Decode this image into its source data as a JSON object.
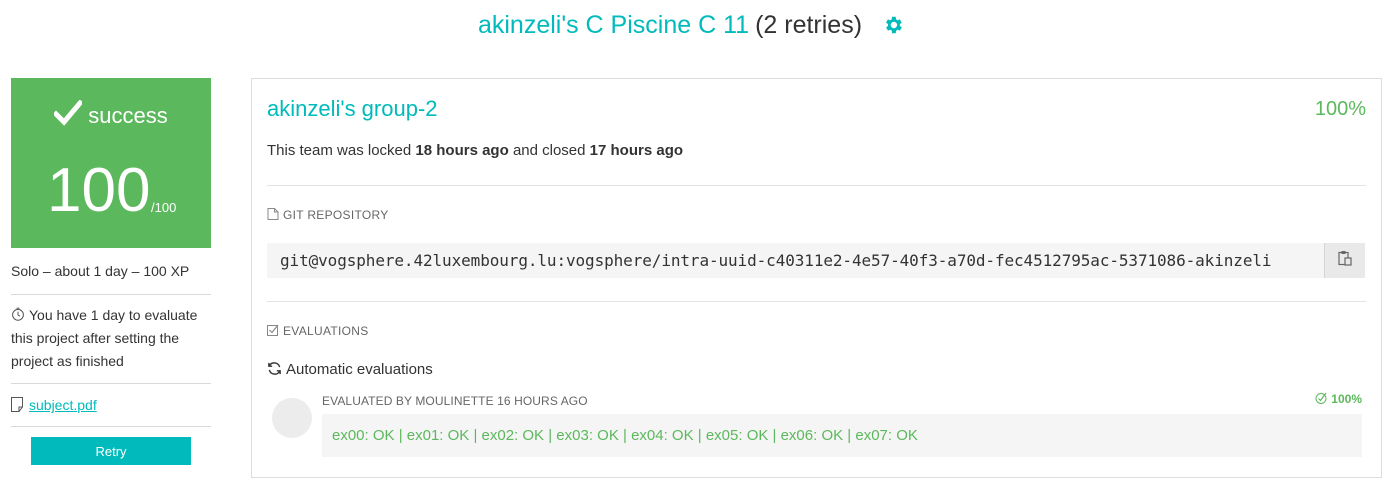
{
  "header": {
    "project_link": "akinzeli's C Piscine C 11",
    "retries": "(2 retries)",
    "gear_icon": "gear-icon"
  },
  "colors": {
    "accent": "#00babc",
    "success": "#5cb85c",
    "text": "#333333"
  },
  "mark": {
    "status": "success",
    "value": "100",
    "max": "/100",
    "check_icon": "checkmark-icon"
  },
  "sidebar": {
    "info": "Solo – about 1 day – 100 XP",
    "eval_note": "You have 1 day to evaluate this project after setting the project as finished",
    "subject_link": "subject.pdf",
    "retry_label": "Retry"
  },
  "team": {
    "name": "akinzeli's group-2",
    "percent": "100%",
    "lock_prefix": "This team was locked",
    "locked_time": "18 hours ago",
    "lock_middle": "and closed",
    "closed_time": "17 hours ago"
  },
  "repository": {
    "label": "GIT REPOSITORY",
    "url": "git@vogsphere.42luxembourg.lu:vogsphere/intra-uuid-c40311e2-4e57-40f3-a70d-fec4512795ac-5371086-akinzeli",
    "copy_icon": "clipboard-icon"
  },
  "evaluations": {
    "label": "EVALUATIONS",
    "automatic_label": "Automatic evaluations",
    "evaluated_by": "EVALUATED BY MOULINETTE 16 HOURS AGO",
    "percent": "100%",
    "result": "ex00: OK | ex01: OK | ex02: OK | ex03: OK | ex04: OK | ex05: OK | ex06: OK | ex07: OK"
  }
}
